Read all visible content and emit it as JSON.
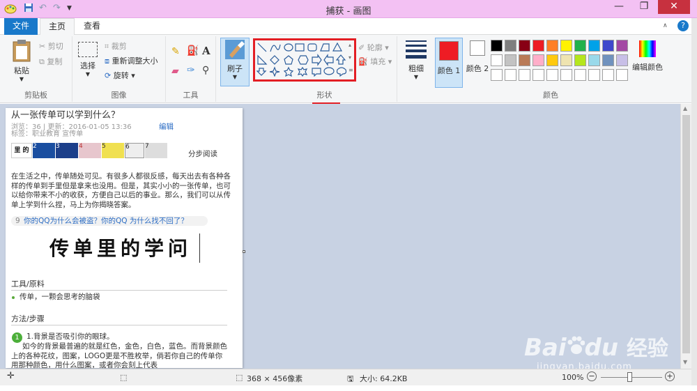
{
  "window": {
    "title": "捕获 - 画图",
    "minimize_glyph": "—",
    "maximize_glyph": "❐",
    "close_glyph": "✕"
  },
  "quick_access": {
    "undo_glyph": "↶",
    "redo_glyph": "↷"
  },
  "tabs": {
    "file": "文件",
    "home": "主页",
    "view": "查看"
  },
  "clipboard": {
    "paste": "粘贴",
    "cut": "剪切",
    "copy": "复制",
    "label": "剪贴板"
  },
  "image_group": {
    "select": "选择",
    "crop": "裁剪",
    "resize": "重新调整大小",
    "rotate": "旋转",
    "label": "图像"
  },
  "tools_group": {
    "label": "工具",
    "text_glyph": "A"
  },
  "brush": {
    "label": "刷子"
  },
  "shapes": {
    "outline": "轮廓",
    "fill": "填充",
    "label": "形状"
  },
  "size": {
    "label": "粗细"
  },
  "colors": {
    "color1": "颜色 1",
    "color2": "颜色 2",
    "edit": "编辑颜色",
    "label": "颜色",
    "color1_value": "#ee1c24",
    "color2_value": "#ffffff",
    "palette_row1": [
      "#000000",
      "#7f7f7f",
      "#880015",
      "#ed1c24",
      "#ff7f27",
      "#fff200",
      "#22b14c",
      "#00a2e8",
      "#3f48cc",
      "#a349a4"
    ],
    "palette_row2": [
      "#ffffff",
      "#c3c3c3",
      "#b97a57",
      "#ffaec9",
      "#ffc90e",
      "#efe4b0",
      "#b5e61d",
      "#99d9ea",
      "#7092be",
      "#c8bfe7"
    ]
  },
  "article": {
    "title": "从一张传单可以学到什么？",
    "meta": "浏览：36 | 更新：2016-01-05 13:36",
    "edit": "编辑",
    "tags": "标签：职业教育 宣传单",
    "thumbs": [
      "1",
      "2",
      "3",
      "4",
      "5",
      "6",
      "7"
    ],
    "thumb1_text": "里 的",
    "step_read": "分步阅读",
    "intro": "在生活之中，传单随处可见。有很多人都很反感，每天出去有各种各样的传单到手里但是拿来也没用。但是，其实小小的一张传单，也可以给你带来不小的收获，方便自己以后的事业。那么，我们可以从传单上学到什么捏，马上为你揭晓答案。",
    "related_count": "9",
    "related": "你的QQ为什么会被盗？你的QQ 为什么找不回了？",
    "calligraphy": "传单里的学问",
    "tools_heading": "工具/原料",
    "tools_item": "传单，一颗会思考的脑袋",
    "method_heading": "方法/步骤",
    "step1_num": "1",
    "step1_title": "1.背景是否吸引你的眼球。",
    "step1_body": "如今的背景最普遍的就是红色，金色，白色，蓝色。而背景颜色上的各种花纹，图案，LOGO更是不胜枚举，倘若你自己的传单你用那种颜色，用什么图案，或者你会刻上代表"
  },
  "statusbar": {
    "dimensions": "368 × 456像素",
    "size": "大小: 64.2KB",
    "zoom": "100%"
  },
  "watermark": {
    "brand": "Bai",
    "brand2": "du",
    "cn": "经验",
    "url": "jingyan.baidu.com"
  },
  "accent_highlight": "#e31e24"
}
